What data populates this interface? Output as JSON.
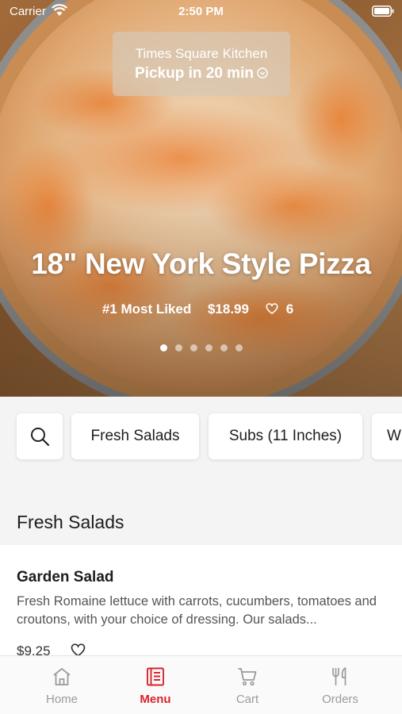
{
  "status_bar": {
    "carrier": "Carrier",
    "time": "2:50 PM"
  },
  "pickup": {
    "location": "Times Square Kitchen",
    "time_text": "Pickup in 20 min"
  },
  "hero": {
    "title": "18\" New York Style Pizza",
    "badge": "#1 Most Liked",
    "price": "$18.99",
    "likes": "6",
    "slide_count": 6,
    "active_slide": 1
  },
  "categories": {
    "search_icon": "search-icon",
    "chips": [
      "Fresh Salads",
      "Subs (11 Inches)",
      "W"
    ]
  },
  "section": {
    "title": "Fresh Salads",
    "items": [
      {
        "name": "Garden Salad",
        "description": "Fresh Romaine lettuce with carrots, cucumbers, tomatoes and croutons, with your choice of dressing. Our salads...",
        "price": "$9.25"
      }
    ]
  },
  "tabs": [
    {
      "label": "Home",
      "icon": "home-icon",
      "active": false
    },
    {
      "label": "Menu",
      "icon": "menu-book-icon",
      "active": true
    },
    {
      "label": "Cart",
      "icon": "cart-icon",
      "active": false
    },
    {
      "label": "Orders",
      "icon": "fork-knife-icon",
      "active": false
    }
  ],
  "colors": {
    "accent": "#d9232e",
    "inactive_tab": "#9b9b9b"
  }
}
